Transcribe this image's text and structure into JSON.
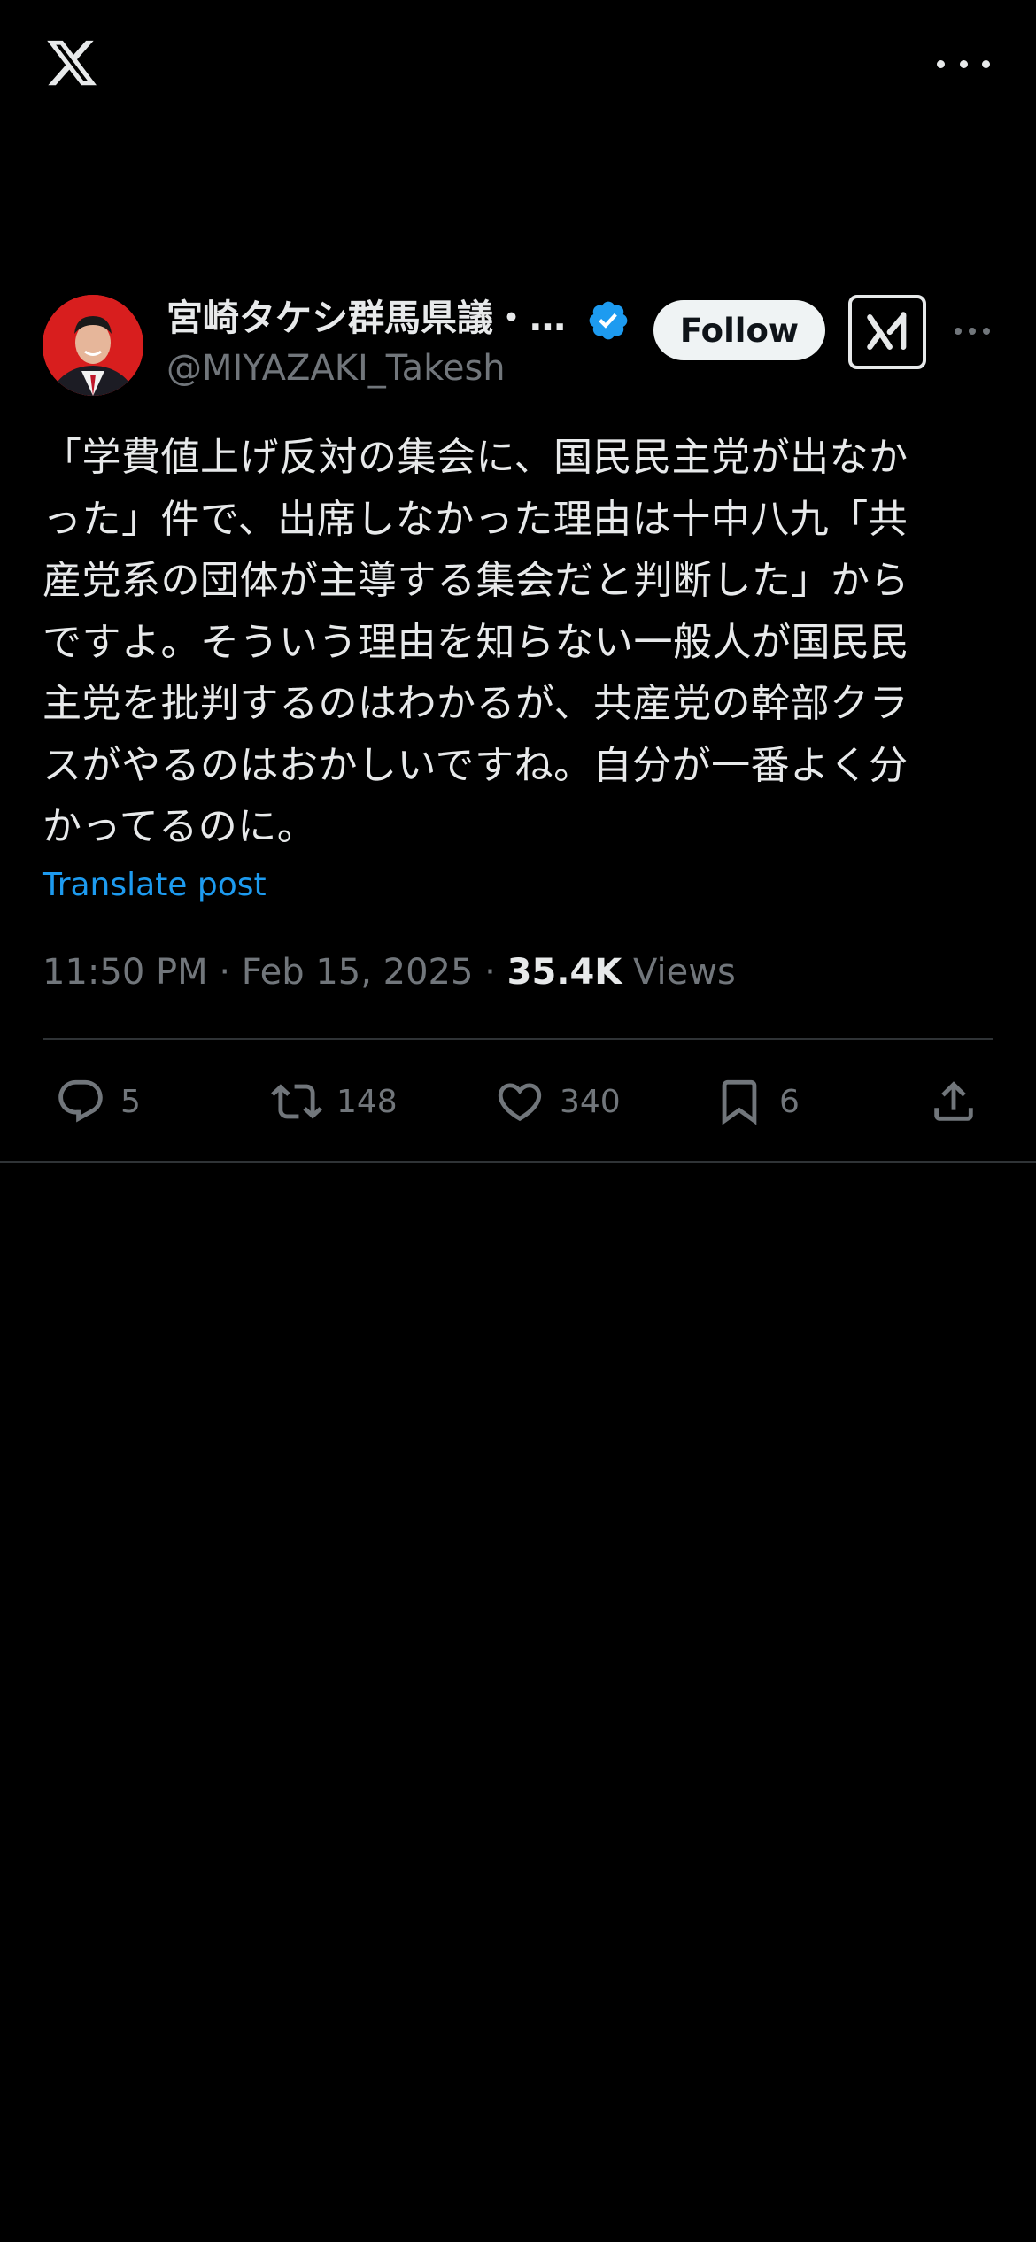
{
  "top_bar": {
    "logo_icon": "x-logo-icon",
    "more_icon": "more-horizontal-icon"
  },
  "author": {
    "display_name": "宮崎タケシ群馬県議・…",
    "handle": "@MIYAZAKI_Takesh",
    "verified": true,
    "verified_color": "#1d9bf0",
    "avatar_bg": "#d81e1e"
  },
  "actions_top": {
    "follow_label": "Follow",
    "grok_icon": "grok-icon",
    "more_icon": "more-horizontal-icon"
  },
  "tweet": {
    "lines": [
      "「学費値上げ反対の集会に、国民民主党が出なか",
      "った」件で、出席しなかった理由は十中八九「共",
      "産党系の団体が主導する集会だと判断した」から",
      "ですよ。そういう理由を知らない一般人が国民民",
      "主党を批判するのはわかるが、共産党の幹部クラ",
      "スがやるのはおかしいですね。自分が一番よく分",
      "かってるのに。"
    ],
    "translate_label": "Translate post",
    "time": "11:50 PM",
    "separator": "·",
    "date": "Feb 15, 2025",
    "views_count": "35.4K",
    "views_label": "Views"
  },
  "engagement": {
    "replies": "5",
    "reposts": "148",
    "likes": "340",
    "bookmarks": "6"
  },
  "colors": {
    "background": "#000000",
    "text_primary": "#e7e9ea",
    "text_secondary": "#71767b",
    "link": "#1d9bf0",
    "divider": "#2f3336"
  }
}
